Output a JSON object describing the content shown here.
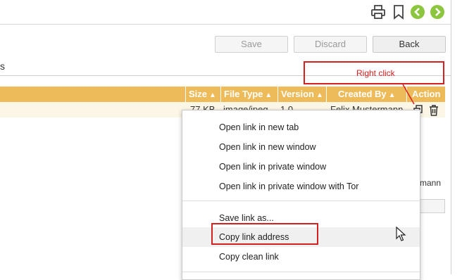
{
  "toolbar": {
    "icons": [
      "printer-icon",
      "bookmark-icon",
      "back-arrow-icon",
      "forward-arrow-icon"
    ],
    "accent": "#8cc63f"
  },
  "actions": {
    "save": "Save",
    "discard": "Discard",
    "back": "Back"
  },
  "tab_fragment": "s",
  "annotation": {
    "label": "Right click",
    "color": "#d62020"
  },
  "table": {
    "header_color": "#edbb5a",
    "columns": [
      "Size",
      "File Type",
      "Version",
      "Created By",
      "Action"
    ],
    "row": {
      "size": "77 KB",
      "file_type": "image/jpeg",
      "version": "1.0",
      "created_by": "Felix Mustermann"
    },
    "row_icons": [
      "copy-link-icon",
      "trash-icon"
    ]
  },
  "peek": {
    "name_fragment": "mann"
  },
  "context_menu": {
    "groups": [
      [
        "Open link in new tab",
        "Open link in new window",
        "Open link in private window",
        "Open link in private window with Tor"
      ],
      [
        "Save link as...",
        "Copy link address",
        "Copy clean link"
      ]
    ],
    "highlighted": "Copy link address"
  }
}
